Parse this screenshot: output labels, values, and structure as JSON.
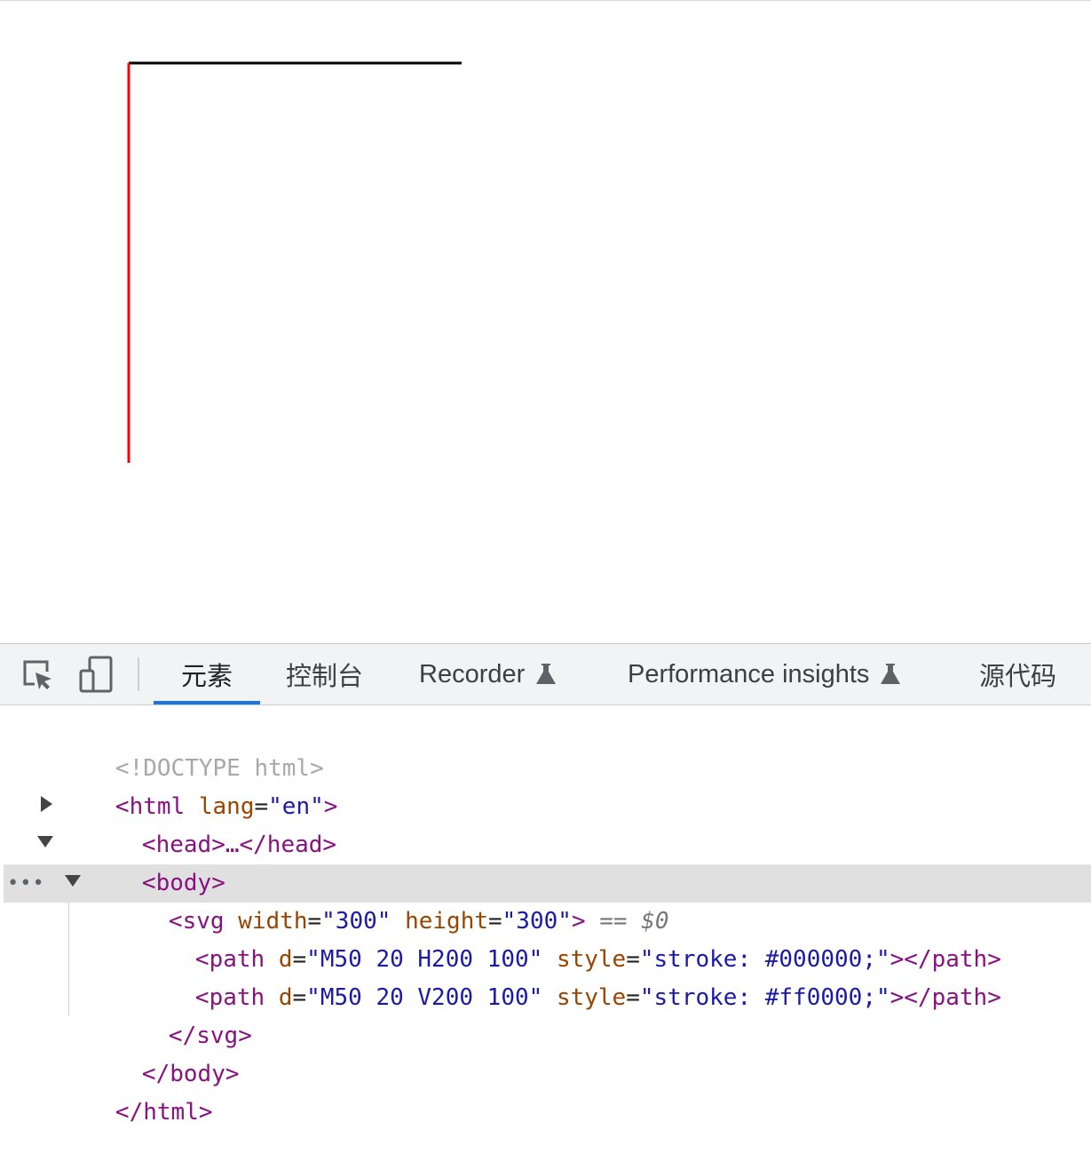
{
  "devtools": {
    "toolbar": {
      "inspect_icon": "inspect-element-icon",
      "device_icon": "device-toolbar-icon",
      "tabs": [
        {
          "label": "元素",
          "active": true
        },
        {
          "label": "控制台",
          "active": false
        },
        {
          "label": "Recorder",
          "active": false,
          "icon": "flask-icon"
        },
        {
          "label": "Performance insights",
          "active": false,
          "icon": "flask-icon"
        },
        {
          "label": "源代码",
          "active": false
        }
      ]
    },
    "dom": {
      "doctype": "<!DOCTYPE html>",
      "html_open": {
        "tag_start": "<html",
        "attr": "lang",
        "eq": "=",
        "value": "\"en\"",
        "tag_end": ">"
      },
      "head_collapsed": "<head>…</head>",
      "body_open": "<body>",
      "svg_open": {
        "tag_start": "<svg",
        "attr1": "width",
        "value1": "\"300\"",
        "attr2": "height",
        "value2": "\"300\"",
        "tag_end": ">",
        "console_ref": "== $0"
      },
      "path1": {
        "tag_start": "<path",
        "attr_d": "d",
        "value_d": "\"M50 20 H200 100\"",
        "attr_style": "style",
        "value_style": "\"stroke: #000000;\"",
        "tag_end": "></path>"
      },
      "path2": {
        "tag_start": "<path",
        "attr_d": "d",
        "value_d": "\"M50 20 V200 100\"",
        "attr_style": "style",
        "value_style": "\"stroke: #ff0000;\"",
        "tag_end": "></path>"
      },
      "svg_close": "</svg>",
      "body_close": "</body>",
      "html_close": "</html>"
    },
    "selection_menu": "•••"
  },
  "colors": {
    "path1_stroke": "#000000",
    "path2_stroke": "#ff0000",
    "active_tab_accent": "#1a73e8",
    "selected_row": "#e0e0e0"
  }
}
